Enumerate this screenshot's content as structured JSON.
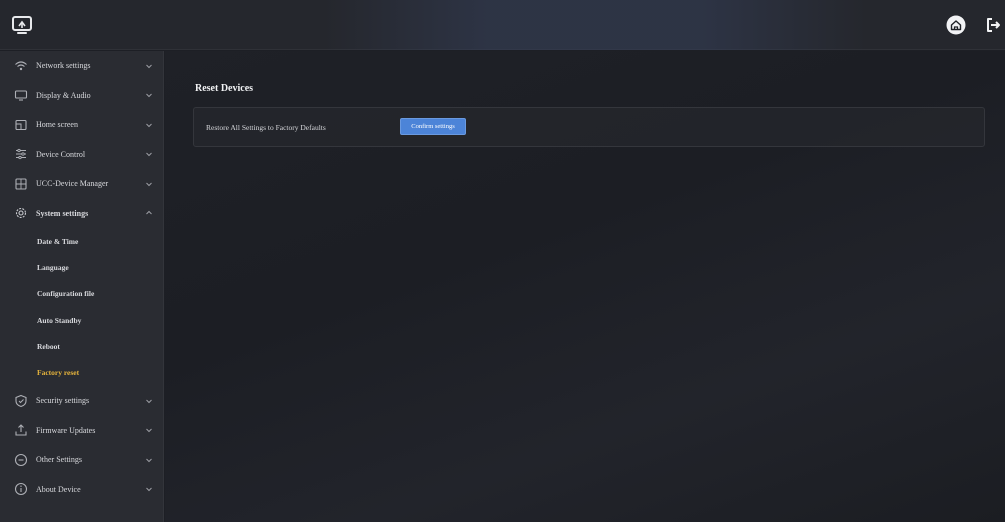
{
  "header": {
    "logo_icon": "screen-share-icon",
    "home_icon": "home-icon",
    "logout_icon": "logout-icon"
  },
  "sidebar": {
    "items": [
      {
        "label": "Network settings",
        "icon": "wifi-icon",
        "expanded": false
      },
      {
        "label": "Display & Audio",
        "icon": "monitor-icon",
        "expanded": false
      },
      {
        "label": "Home screen",
        "icon": "home-screen-icon",
        "expanded": false
      },
      {
        "label": "Device Control",
        "icon": "sliders-icon",
        "expanded": false
      },
      {
        "label": "UCC-Device Manager",
        "icon": "device-manager-icon",
        "expanded": false
      },
      {
        "label": "System settings",
        "icon": "gear-icon",
        "expanded": true
      },
      {
        "label": "Security settings",
        "icon": "shield-icon",
        "expanded": false
      },
      {
        "label": "Firmware Updates",
        "icon": "upload-icon",
        "expanded": false
      },
      {
        "label": "Other Settings",
        "icon": "circle-minus-icon",
        "expanded": false
      },
      {
        "label": "About Device",
        "icon": "info-icon",
        "expanded": false
      }
    ],
    "system_subitems": [
      {
        "label": "Date & Time"
      },
      {
        "label": "Language"
      },
      {
        "label": "Configuration file"
      },
      {
        "label": "Auto Standby"
      },
      {
        "label": "Reboot"
      },
      {
        "label": "Factory reset",
        "active": true
      }
    ]
  },
  "main": {
    "section_title": "Reset Devices",
    "reset_row": {
      "label": "Restore All Settings to Factory Defaults",
      "button_label": "Confirm settings"
    }
  },
  "colors": {
    "accent": "#4c84d8",
    "active_text": "#e6b43c",
    "sidebar_bg": "#2a2c32",
    "content_bg": "#1d1f25"
  }
}
